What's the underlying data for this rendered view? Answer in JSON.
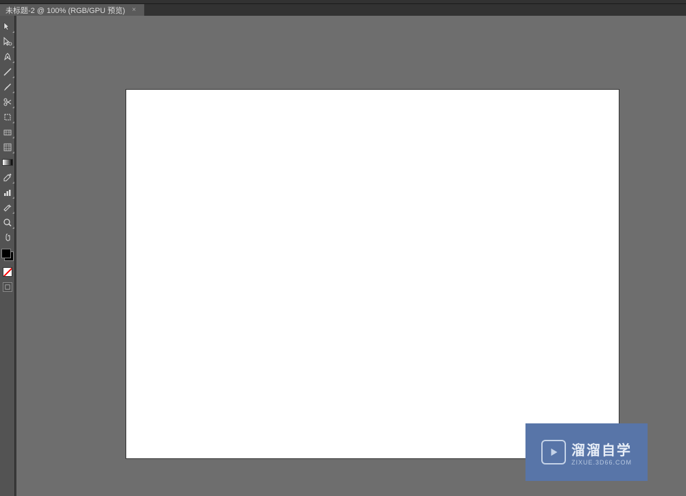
{
  "tab": {
    "title": "未标题-2 @ 100% (RGB/GPU 预览)",
    "close": "×"
  },
  "tools": [
    {
      "name": "selection-tool",
      "icon": "arrow"
    },
    {
      "name": "direct-selection-tool",
      "icon": "arrow-white"
    },
    {
      "name": "pen-tool",
      "icon": "pen"
    },
    {
      "name": "line-tool",
      "icon": "line"
    },
    {
      "name": "brush-tool",
      "icon": "brush"
    },
    {
      "name": "scissors-tool",
      "icon": "scissors"
    },
    {
      "name": "artboard-tool",
      "icon": "artboard"
    },
    {
      "name": "perspective-tool",
      "icon": "grid"
    },
    {
      "name": "gradient-tool",
      "icon": "gradient-bar"
    },
    {
      "name": "eyedropper-tool",
      "icon": "eyedropper"
    },
    {
      "name": "graph-tool",
      "icon": "graph"
    },
    {
      "name": "slice-tool",
      "icon": "slice"
    },
    {
      "name": "zoom-tool",
      "icon": "zoom"
    },
    {
      "name": "hand-tool",
      "icon": "hand"
    }
  ],
  "watermark": {
    "title": "溜溜自学",
    "url": "ZIXUE.3D66.COM"
  }
}
